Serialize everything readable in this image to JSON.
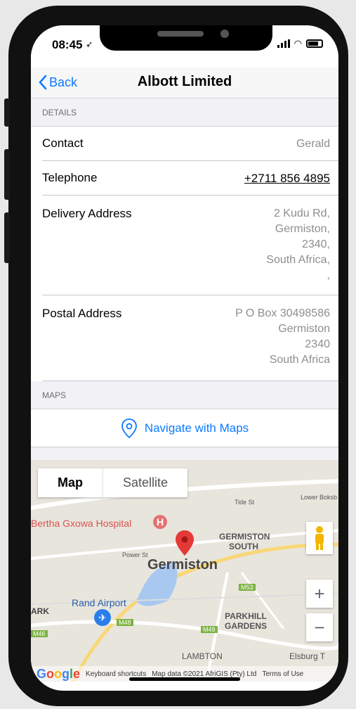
{
  "status": {
    "time": "08:45"
  },
  "nav": {
    "back_label": "Back",
    "title": "Albott Limited"
  },
  "details": {
    "header": "DETAILS",
    "contact": {
      "label": "Contact",
      "value": "Gerald"
    },
    "telephone": {
      "label": "Telephone",
      "value": "+2711 856 4895"
    },
    "delivery": {
      "label": "Delivery Address",
      "lines": [
        "2 Kudu Rd,",
        "Germiston,",
        "2340,",
        "South Africa,",
        ","
      ]
    },
    "postal": {
      "label": "Postal Address",
      "lines": [
        "P O Box 30498586",
        "Germiston",
        "2340",
        "South Africa"
      ]
    }
  },
  "maps": {
    "header": "MAPS",
    "navigate_label": "Navigate with Maps",
    "tab_map": "Map",
    "tab_satellite": "Satellite",
    "labels": {
      "hospital": "Bertha Gxowa Hospital",
      "germiston": "Germiston",
      "germiston_south": "GERMISTON SOUTH",
      "rand_airport": "Rand Airport",
      "parkhill": "PARKHILL GARDENS",
      "lambton": "LAMBTON",
      "elsburg": "Elsburg T",
      "tide": "Tide St",
      "power": "Power St",
      "lower": "Lower Boksb",
      "ark": "ARK",
      "m53": "M53",
      "m48": "M48",
      "m49": "M49",
      "m46": "M46"
    },
    "zoom_in": "+",
    "zoom_out": "−",
    "footer": {
      "logo": "Google",
      "shortcuts": "Keyboard shortcuts",
      "map_data": "Map data ©2021 AfriGIS (Pty) Ltd",
      "terms": "Terms of Use"
    }
  },
  "colors": {
    "accent": "#0a7aff",
    "pin": "#e53935",
    "water": "#a8c8f0",
    "road": "#ffffff",
    "route": "#f9d777"
  }
}
